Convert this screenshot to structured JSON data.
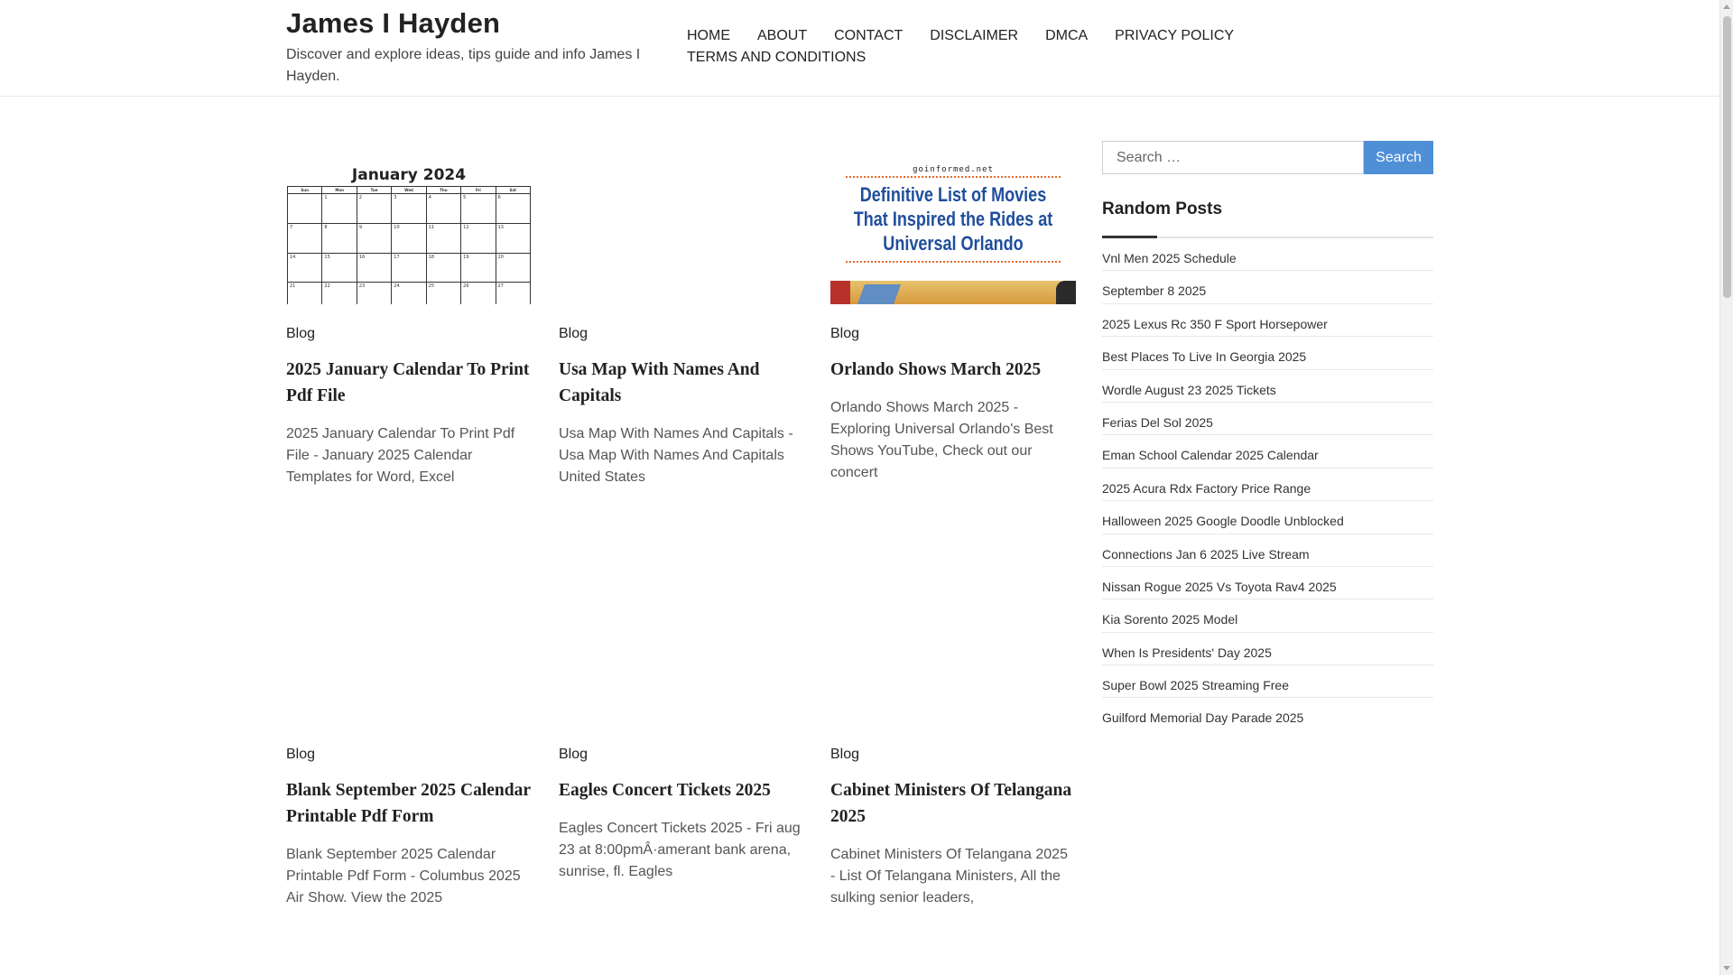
{
  "site": {
    "title": "James I Hayden",
    "description": "Discover and explore ideas, tips guide and info James I Hayden."
  },
  "nav": [
    "HOME",
    "ABOUT",
    "CONTACT",
    "DISCLAIMER",
    "DMCA",
    "PRIVACY POLICY",
    "TERMS AND CONDITIONS"
  ],
  "posts": [
    {
      "category": "Blog",
      "title": "2025 January Calendar To Print Pdf File",
      "excerpt": "2025 January Calendar To Print Pdf File - January 2025 Calendar Templates for Word, Excel",
      "thumbnail": "calendar",
      "thumb_text": "January 2024",
      "weekdays": [
        "Sun",
        "Mon",
        "Tue",
        "Wed",
        "Thu",
        "Fri",
        "Sat"
      ]
    },
    {
      "category": "Blog",
      "title": "Usa Map With Names And Capitals",
      "excerpt": "Usa Map With Names And Capitals - Usa Map With Names And Capitals United States",
      "thumbnail": "none"
    },
    {
      "category": "Blog",
      "title": "Orlando Shows March 2025",
      "excerpt": "Orlando Shows March 2025 - Exploring Universal Orlando's Best Shows YouTube, Check out our concert",
      "thumbnail": "poster",
      "thumb_site": "goinformed.net",
      "thumb_text": "Definitive List of Movies That Inspired the Rides at Universal Orlando"
    },
    {
      "category": "Blog",
      "title": "Blank September 2025 Calendar Printable Pdf Form",
      "excerpt": "Blank September 2025 Calendar Printable Pdf Form - Columbus 2025 Air Show. View the 2025",
      "thumbnail": "none"
    },
    {
      "category": "Blog",
      "title": "Eagles Concert Tickets 2025",
      "excerpt": "Eagles Concert Tickets 2025 - Fri aug 23 at 8:00pmÂ·amerant bank arena, sunrise, fl. Eagles",
      "thumbnail": "none"
    },
    {
      "category": "Blog",
      "title": "Cabinet Ministers Of Telangana 2025",
      "excerpt": "Cabinet Ministers Of Telangana 2025 - List Of Telangana Ministers, All the sulking senior leaders,",
      "thumbnail": "none"
    }
  ],
  "sidebar": {
    "search_placeholder": "Search …",
    "search_button": "Search",
    "widget_title": "Random Posts",
    "random_posts": [
      "Vnl Men 2025 Schedule",
      "September 8 2025",
      "2025 Lexus Rc 350 F Sport Horsepower",
      "Best Places To Live In Georgia 2025",
      "Wordle August 23 2025 Tickets",
      "Ferias Del Sol 2025",
      "Eman School Calendar 2025 Calendar",
      "2025 Acura Rdx Factory Price Range",
      "Halloween 2025 Google Doodle Unblocked",
      "Connections Jan 6 2025 Live Stream",
      "Nissan Rogue 2025 Vs Toyota Rav4 2025",
      "Kia Sorento 2025 Model",
      "When Is Presidents' Day 2025",
      "Super Bowl 2025 Streaming Free",
      "Guilford Memorial Day Parade 2025"
    ]
  },
  "colors": {
    "accent": "#4f8fd6",
    "poster_text": "#1f4e9c"
  }
}
